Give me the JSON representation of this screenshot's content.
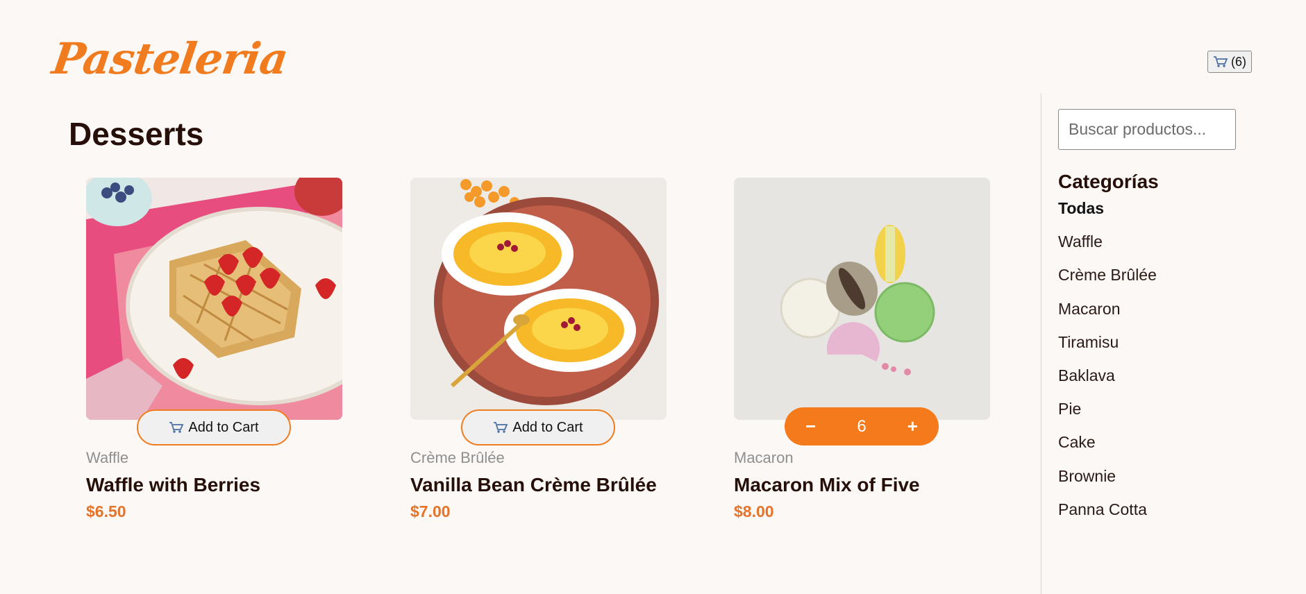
{
  "header": {
    "logo": "Pasteleria",
    "cart_icon": "cart-icon",
    "cart_count": "(6)"
  },
  "main": {
    "title": "Desserts",
    "products": [
      {
        "category": "Waffle",
        "name": "Waffle with Berries",
        "price": "$6.50",
        "button_label": "Add to Cart",
        "in_cart": false
      },
      {
        "category": "Crème Brûlée",
        "name": "Vanilla Bean Crème Brûlée",
        "price": "$7.00",
        "button_label": "Add to Cart",
        "in_cart": false
      },
      {
        "category": "Macaron",
        "name": "Macaron Mix of Five",
        "price": "$8.00",
        "in_cart": true,
        "quantity": "6",
        "decrement": "−",
        "increment": "+"
      }
    ]
  },
  "sidebar": {
    "search_placeholder": "Buscar productos...",
    "categories_title": "Categorías",
    "categories": [
      "Todas",
      "Waffle",
      "Crème Brûlée",
      "Macaron",
      "Tiramisu",
      "Baklava",
      "Pie",
      "Cake",
      "Brownie",
      "Panna Cotta"
    ],
    "active_category": "Todas"
  },
  "colors": {
    "accent": "#f07c1f",
    "price": "#e5732a",
    "background": "#fcf8f5",
    "text": "#260f08"
  }
}
